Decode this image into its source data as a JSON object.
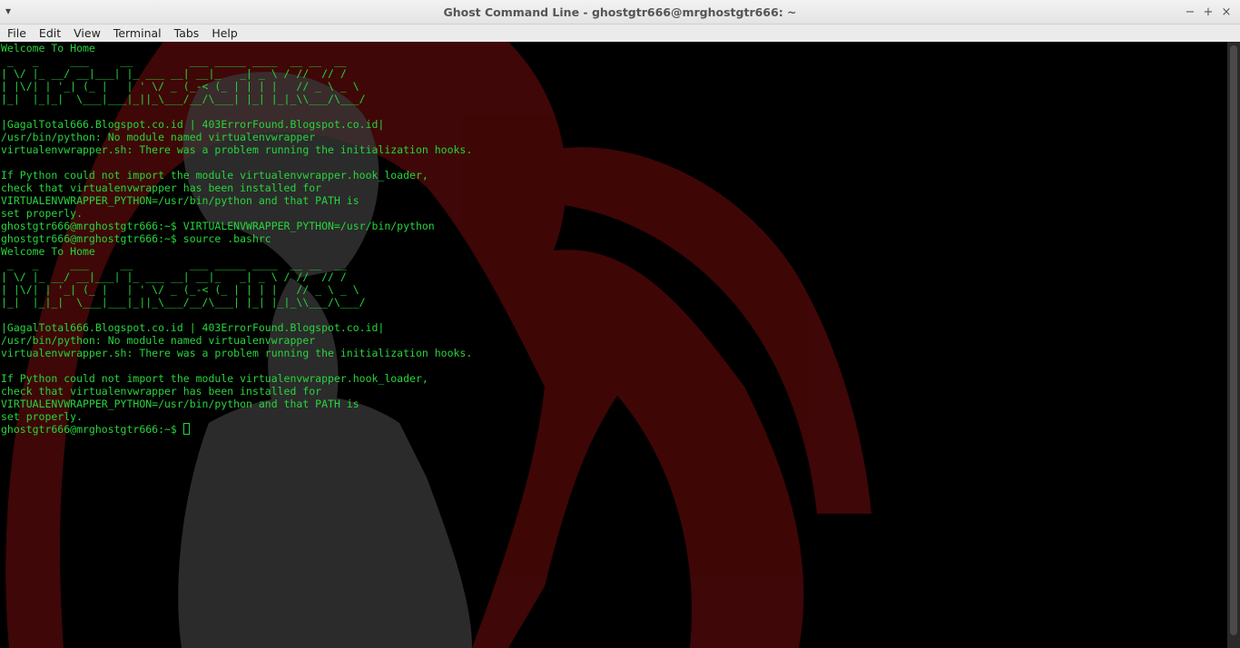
{
  "window": {
    "title": "Ghost Command Line - ghostgtr666@mrghostgtr666: ~",
    "menu_glyph": "▾",
    "controls": {
      "minimize": "−",
      "maximize": "+",
      "close": "×"
    }
  },
  "menubar": [
    "File",
    "Edit",
    "View",
    "Terminal",
    "Tabs",
    "Help"
  ],
  "terminal": {
    "lines": [
      "Welcome To Home",
      " _   _     ___     __         ___ _____ ____  __ __  __ ",
      "| \\/ |_ __/ __|___| |_ ___ __| __|_   _| _ \\ / //  // / ",
      "| |\\/| | '_| (_ |   | ' \\/ _ (_-< (_ | | | |   // _ \\ _ \\",
      "|_|  |_|_|  \\___|___|_||_\\___/__/\\___| |_| |_|_\\\\___/\\___/",
      "",
      "|GagalTotal666.Blogspot.co.id | 403ErrorFound.Blogspot.co.id|",
      "/usr/bin/python: No module named virtualenvwrapper",
      "virtualenvwrapper.sh: There was a problem running the initialization hooks.",
      "",
      "If Python could not import the module virtualenvwrapper.hook_loader,",
      "check that virtualenvwrapper has been installed for",
      "VIRTUALENVWRAPPER_PYTHON=/usr/bin/python and that PATH is",
      "set properly.",
      "ghostgtr666@mrghostgtr666:~$ VIRTUALENVWRAPPER_PYTHON=/usr/bin/python",
      "ghostgtr666@mrghostgtr666:~$ source .bashrc",
      "Welcome To Home",
      " _   _     ___     __         ___ _____ ____  __ __  __ ",
      "| \\/ |_ __/ __|___| |_ ___ __| __|_   _| _ \\ / //  // / ",
      "| |\\/| | '_| (_ |   | ' \\/ _ (_-< (_ | | | |   // _ \\ _ \\",
      "|_|  |_|_|  \\___|___|_||_\\___/__/\\___| |_| |_|_\\\\___/\\___/",
      "",
      "|GagalTotal666.Blogspot.co.id | 403ErrorFound.Blogspot.co.id|",
      "/usr/bin/python: No module named virtualenvwrapper",
      "virtualenvwrapper.sh: There was a problem running the initialization hooks.",
      "",
      "If Python could not import the module virtualenvwrapper.hook_loader,",
      "check that virtualenvwrapper has been installed for",
      "VIRTUALENVWRAPPER_PYTHON=/usr/bin/python and that PATH is",
      "set properly."
    ],
    "prompt": "ghostgtr666@mrghostgtr666:~$ ",
    "text_color": "#27d43c",
    "background_color": "#000000",
    "art_colors": {
      "hair": "#4a0808",
      "figure": "#3a3a3a"
    }
  }
}
